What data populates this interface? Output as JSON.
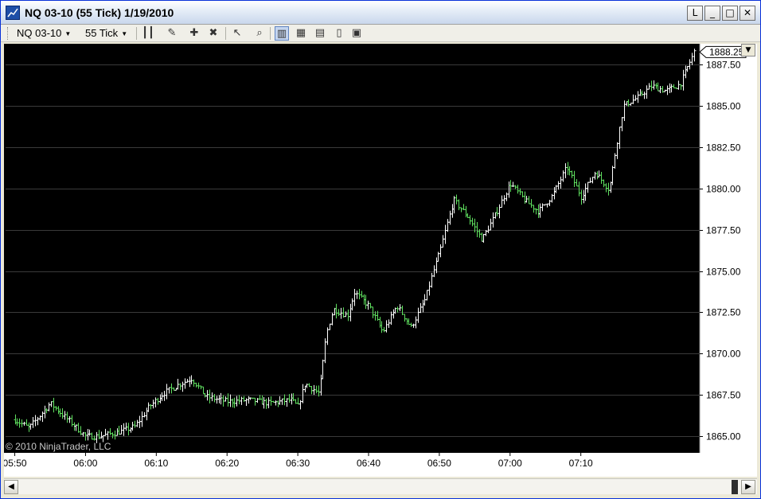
{
  "window": {
    "title": "NQ 03-10 (55 Tick)  1/19/2010",
    "buttons": {
      "link": "L",
      "minimize": "_",
      "maximize": "□",
      "close": "✕"
    }
  },
  "toolbar": {
    "instrument": "NQ 03-10",
    "interval": "55 Tick",
    "icons": [
      "bar-type-icon",
      "drawing-pencil-icon",
      "add-marker-icon",
      "remove-marker-icon",
      "cursor-mode-icon",
      "zoom-icon",
      "chart-style-icon",
      "indicator-icon",
      "strategy-icon",
      "data-box-icon",
      "properties-icon"
    ]
  },
  "chart": {
    "copyright": "© 2010 NinjaTrader, LLC",
    "last_price_label": "1888.25",
    "colors": {
      "background": "#000000",
      "grid": "#3a3a3a",
      "up": "#ffffff",
      "down": "#5fe05f",
      "axis_text": "#000000"
    }
  },
  "chart_data": {
    "type": "bar",
    "instrument": "NQ 03-10",
    "interval": "55 Tick",
    "date": "1/19/2010",
    "y_ticks": [
      "1865.00",
      "1867.50",
      "1870.00",
      "1872.50",
      "1875.00",
      "1877.50",
      "1880.00",
      "1882.50",
      "1885.00",
      "1887.50"
    ],
    "x_ticks": [
      "05:50",
      "06:00",
      "06:10",
      "06:20",
      "06:30",
      "06:40",
      "06:50",
      "07:00",
      "07:10"
    ],
    "ylim": [
      1864.0,
      1888.75
    ],
    "x_minutes_range": [
      "05:49",
      "07:26"
    ],
    "grid": true,
    "last_price": 1888.25,
    "price_path": [
      [
        "05:50",
        1866.0
      ],
      [
        "05:52",
        1865.5
      ],
      [
        "05:55",
        1867.0
      ],
      [
        "05:58",
        1865.8
      ],
      [
        "06:00",
        1865.0
      ],
      [
        "06:02",
        1865.0
      ],
      [
        "06:05",
        1865.3
      ],
      [
        "06:07",
        1865.6
      ],
      [
        "06:09",
        1866.8
      ],
      [
        "06:11",
        1867.6
      ],
      [
        "06:13",
        1868.1
      ],
      [
        "06:15",
        1868.5
      ],
      [
        "06:17",
        1867.4
      ],
      [
        "06:20",
        1867.1
      ],
      [
        "06:23",
        1867.2
      ],
      [
        "06:26",
        1867.0
      ],
      [
        "06:29",
        1867.2
      ],
      [
        "06:30",
        1866.8
      ],
      [
        "06:31",
        1868.2
      ],
      [
        "06:33",
        1867.6
      ],
      [
        "06:34",
        1871.2
      ],
      [
        "06:35",
        1872.7
      ],
      [
        "06:37",
        1872.3
      ],
      [
        "06:38",
        1873.7
      ],
      [
        "06:40",
        1872.9
      ],
      [
        "06:42",
        1871.3
      ],
      [
        "06:44",
        1872.9
      ],
      [
        "06:46",
        1871.6
      ],
      [
        "06:48",
        1873.3
      ],
      [
        "06:49",
        1874.8
      ],
      [
        "06:50",
        1876.1
      ],
      [
        "06:52",
        1879.3
      ],
      [
        "06:54",
        1878.3
      ],
      [
        "06:56",
        1876.9
      ],
      [
        "06:58",
        1878.5
      ],
      [
        "07:00",
        1880.3
      ],
      [
        "07:02",
        1879.3
      ],
      [
        "07:04",
        1878.6
      ],
      [
        "07:06",
        1879.6
      ],
      [
        "07:08",
        1881.3
      ],
      [
        "07:10",
        1879.5
      ],
      [
        "07:12",
        1881.0
      ],
      [
        "07:14",
        1879.9
      ],
      [
        "07:15",
        1882.6
      ],
      [
        "07:16",
        1885.0
      ],
      [
        "07:18",
        1885.5
      ],
      [
        "07:20",
        1886.2
      ],
      [
        "07:22",
        1885.9
      ],
      [
        "07:24",
        1886.3
      ],
      [
        "07:25",
        1887.3
      ],
      [
        "07:26",
        1888.25
      ]
    ]
  }
}
